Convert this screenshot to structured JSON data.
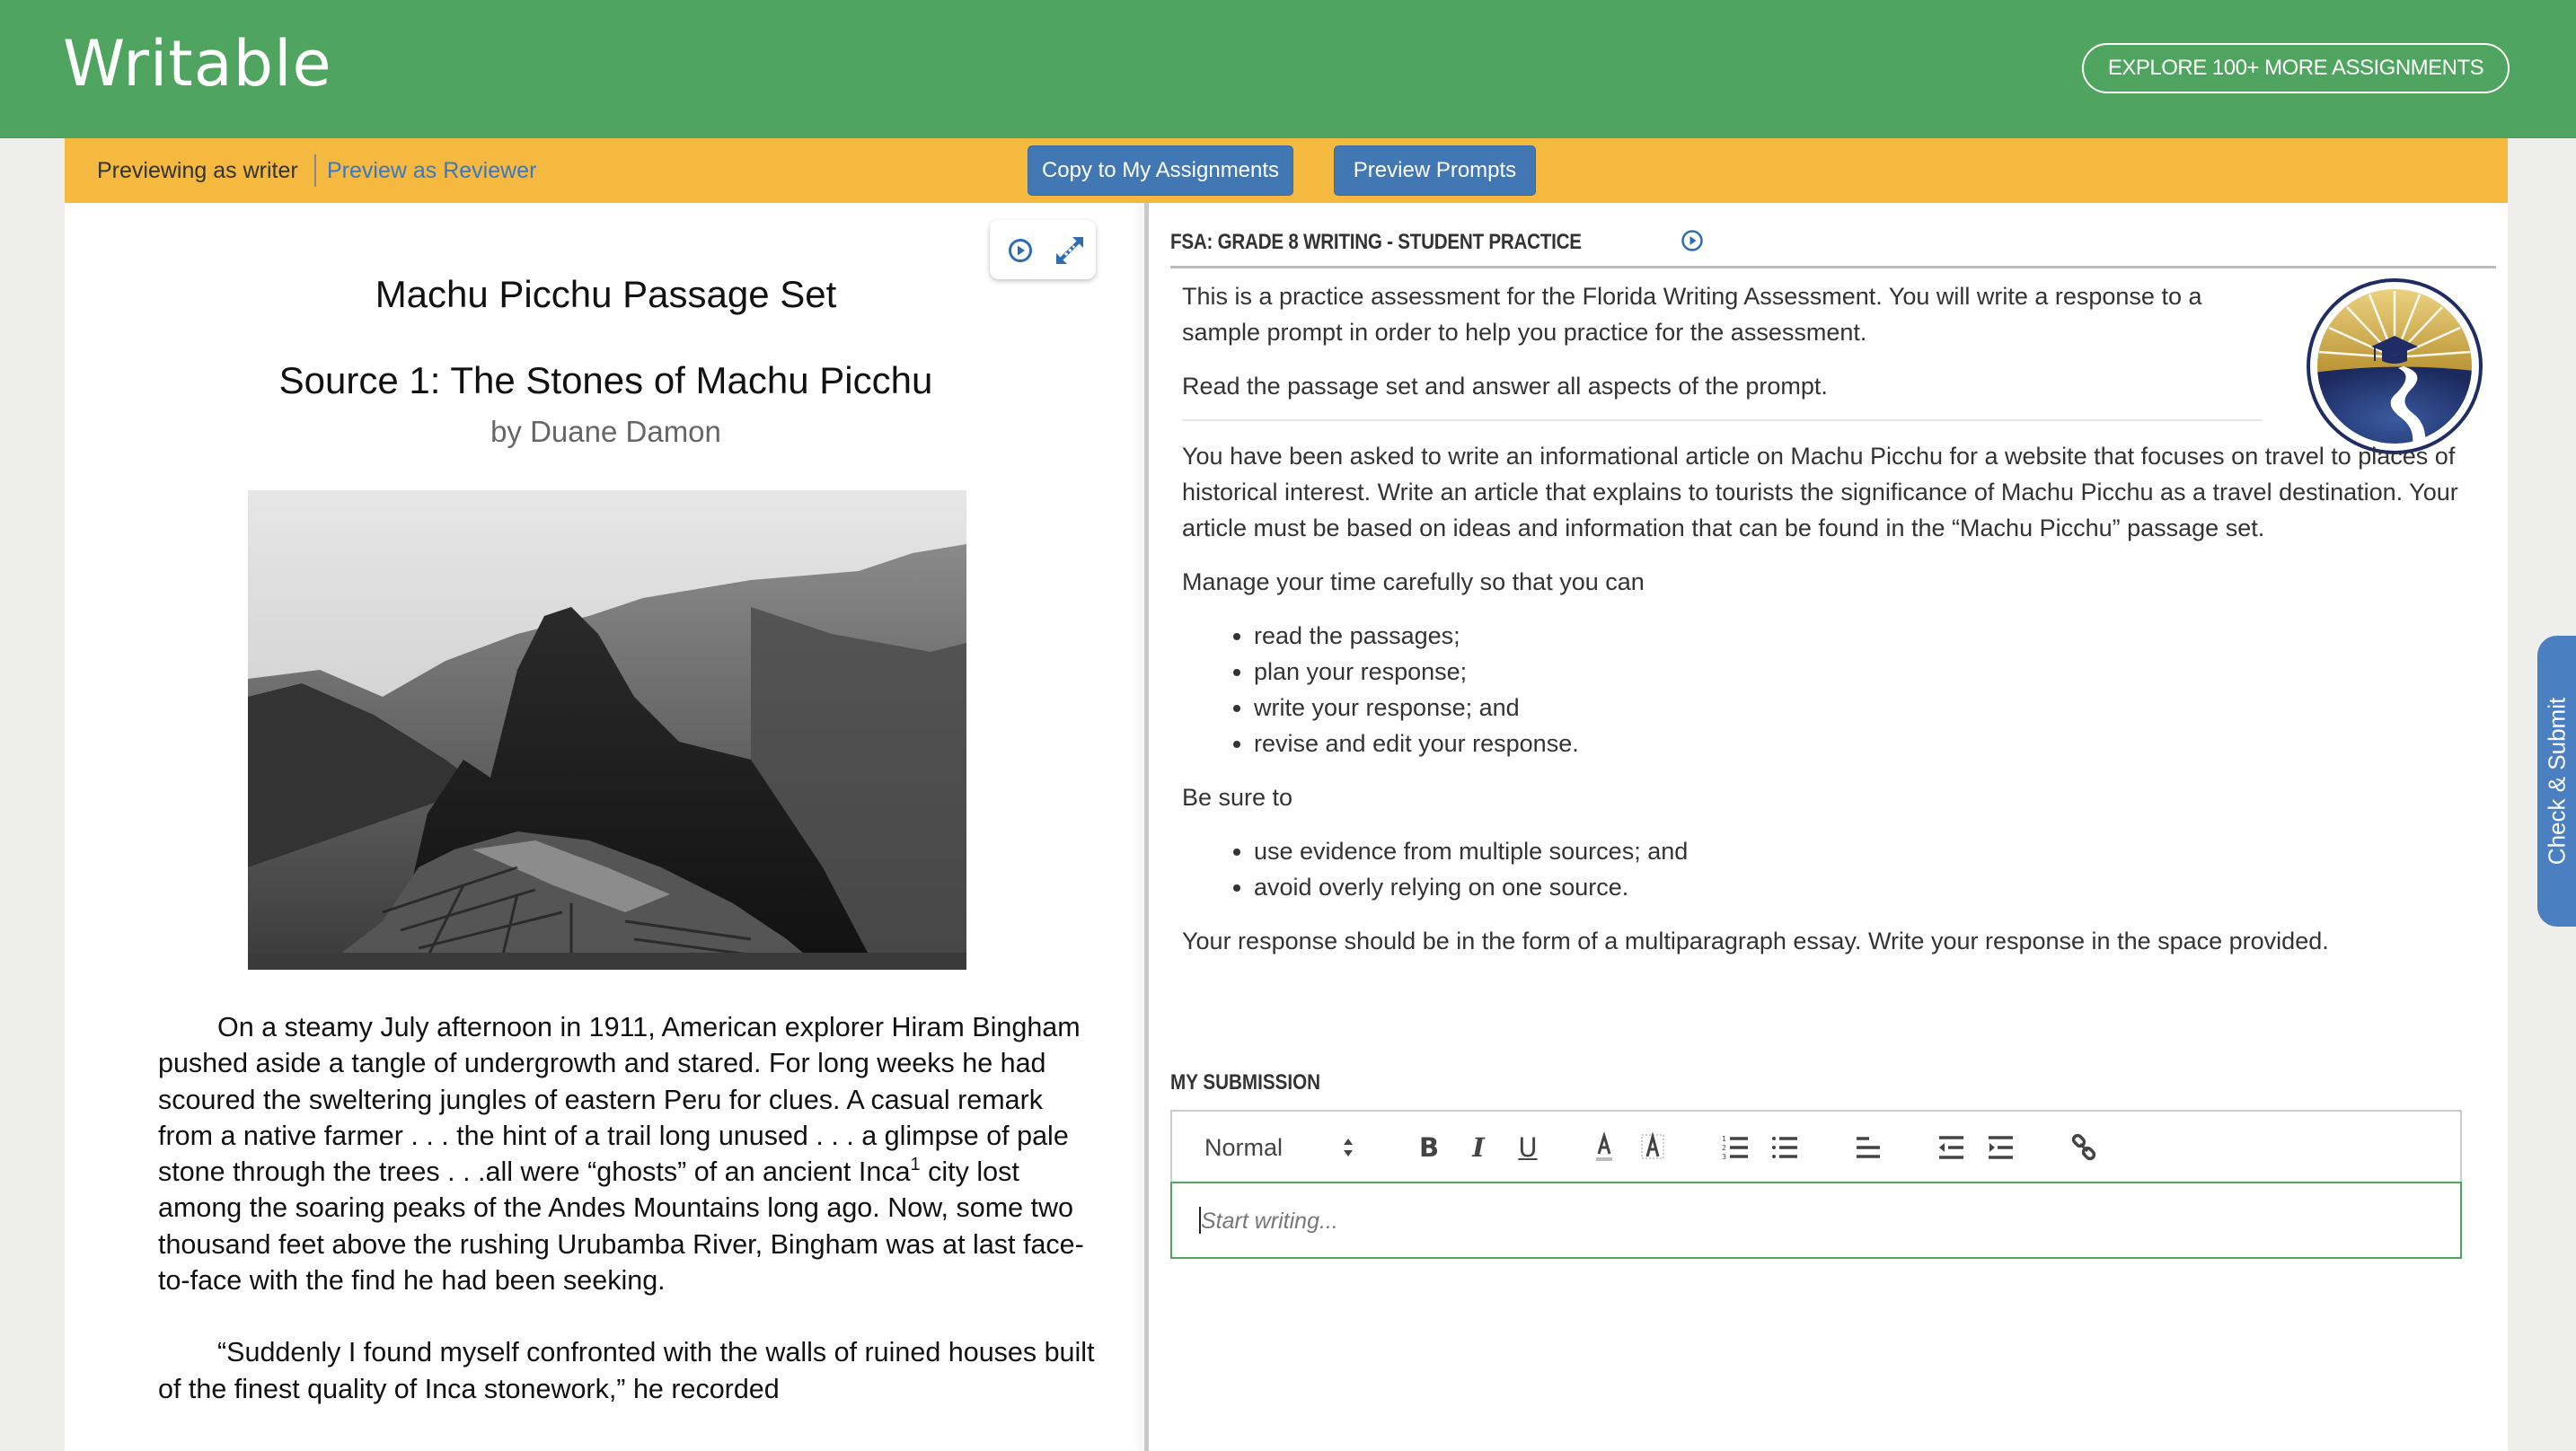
{
  "header": {
    "logo": "Writable",
    "explore_button": "EXPLORE 100+ MORE ASSIGNMENTS",
    "brand_color": "#4fa55f"
  },
  "preview_bar": {
    "previewing_as": "Previewing as writer",
    "preview_as_reviewer": "Preview as Reviewer",
    "copy_button": "Copy to My Assignments",
    "preview_prompts_button": "Preview Prompts",
    "bar_color": "#f4b93e",
    "button_color": "#4177b2"
  },
  "left_pane": {
    "tools": [
      "play-audio-icon",
      "expand-icon"
    ],
    "title": "Machu Picchu Passage Set",
    "source_title": "Source 1: The Stones of Machu Picchu",
    "author": "by Duane Damon",
    "image_alt": "Black and white photo of Machu Picchu ruins with Huayna Picchu mountain behind",
    "paragraphs": [
      {
        "before_sup": "On a steamy July afternoon in 1911, American explorer Hiram Bingham pushed aside a tangle of undergrowth and stared. For long weeks he had scoured the sweltering jungles of eastern Peru for clues. A casual remark from a native farmer . . . the hint of a trail long unused . . . a glimpse of pale stone through the trees . . .all were “ghosts” of an ancient Inca",
        "sup": "1",
        "after_sup": " city lost among the soaring peaks of the Andes Mountains long ago. Now, some two thousand feet above the rushing Urubamba River, Bingham was at last face-to-face with the find he had been seeking."
      },
      {
        "text": "“Suddenly I found myself confronted with the walls of ruined houses built of the finest quality of Inca stonework,” he recorded"
      }
    ]
  },
  "right_pane": {
    "heading": "FSA: GRADE 8 WRITING - STUDENT PRACTICE",
    "intro": [
      "This is a practice assessment for the Florida Writing Assessment. You will write a response to a sample prompt in order to help you practice for the assessment.",
      "Read the passage set and answer all aspects of the prompt."
    ],
    "seal_alt": "Florida Department of Education seal",
    "prompt": "You have been asked to write an informational article on Machu Picchu for a website that focuses on travel to places of historical interest. Write an article that explains to tourists the significance of Machu Picchu as a travel destination. Your article must be based on ideas and information that can be found in the “Machu Picchu” passage set.",
    "manage_time": "Manage your time carefully so that you can",
    "manage_list": [
      "read the passages;",
      "plan your response;",
      "write your response; and",
      "revise and edit your response."
    ],
    "be_sure": "Be sure to",
    "be_sure_list": [
      "use evidence from multiple sources; and",
      "avoid overly relying on one source."
    ],
    "closing": "Your response should be in the form of a multiparagraph essay. Write your response in the space provided.",
    "submission_label": "MY SUBMISSION",
    "editor": {
      "format_select": "Normal",
      "placeholder": "Start writing...",
      "value": ""
    }
  },
  "side_tab": {
    "label": "Check & Submit"
  }
}
